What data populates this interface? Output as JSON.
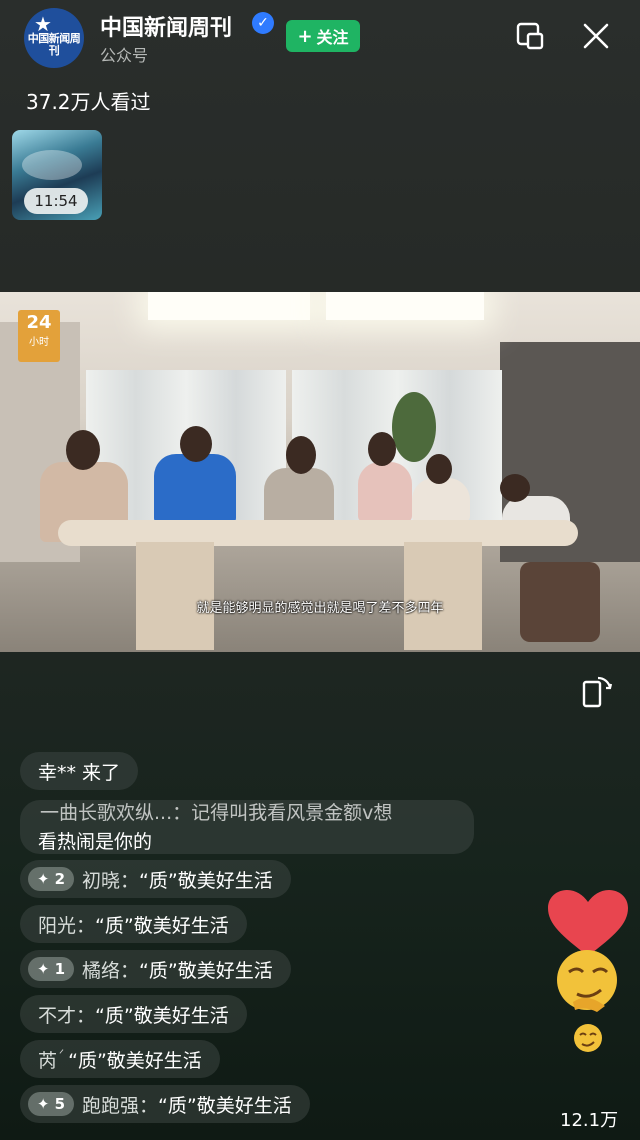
{
  "header": {
    "avatar_text": "中国新闻周刊",
    "channel_name": "中国新闻周刊",
    "channel_type": "公众号",
    "follow_label": "关注",
    "follow_icon": "+",
    "verified_icon": "verified-check-icon"
  },
  "views_text": "37.2万人看过",
  "replay_thumbnail": {
    "duration": "11:54"
  },
  "video": {
    "corner_badge_number": "24",
    "corner_badge_text": "小时",
    "subtitle": "就是能够明显的感觉出就是喝了差不多四年"
  },
  "comments": [
    {
      "user": "",
      "text": "幸** 来了",
      "level": ""
    },
    {
      "user": "一曲长歌欢纵...：",
      "text": "记得叫我看风景金额v想",
      "text2": "看热闹是你的",
      "level": ""
    },
    {
      "user": "初晓：",
      "text": "“质”敬美好生活",
      "level": "2"
    },
    {
      "user": "阳光：",
      "text": "“质”敬美好生活",
      "level": ""
    },
    {
      "user": "橘络：",
      "text": "“质”敬美好生活",
      "level": "1"
    },
    {
      "user": "不才：",
      "text": "“质”敬美好生活",
      "level": ""
    },
    {
      "user": "芮",
      "text": "“质”敬美好生活",
      "level": ""
    },
    {
      "user": "跑跑强：",
      "text": "“质”敬美好生活",
      "level": "5"
    }
  ],
  "likes_count": "12.1万",
  "colors": {
    "follow_green": "#1fb463",
    "verified_blue": "#2f7bff",
    "heart_red": "#e8454f"
  }
}
